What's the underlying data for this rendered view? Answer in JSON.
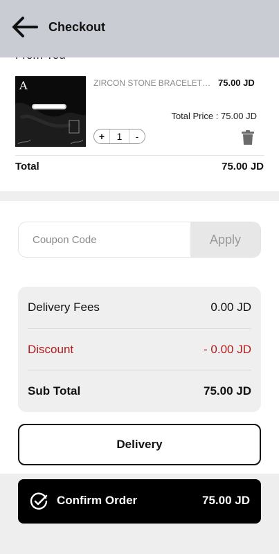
{
  "header": {
    "title": "Checkout",
    "back_icon": "arrow-left-icon"
  },
  "section": {
    "heading_partial": "From You"
  },
  "cart": {
    "items": [
      {
        "name": "ZIRCON STONE BRACELETZ...",
        "price": "75.00 JD",
        "total_price": "Total Price : 75.00 JD",
        "quantity": "1",
        "increase": "+",
        "decrease": "-"
      }
    ],
    "total_label": "Total",
    "total_value": "75.00 JD"
  },
  "coupon": {
    "placeholder": "Coupon Code",
    "value": "",
    "apply_label": "Apply"
  },
  "summary": {
    "delivery_label": "Delivery Fees",
    "delivery_value": "0.00 JD",
    "discount_label": "Discount",
    "discount_value": "- 0.00 JD",
    "subtotal_label": "Sub Total",
    "subtotal_value": "75.00 JD"
  },
  "delivery_button": {
    "label": "Delivery"
  },
  "confirm": {
    "label": "Confirm Order",
    "amount": "75.00 JD",
    "icon": "check-circle-icon"
  },
  "colors": {
    "header_bg": "#c9cdd3",
    "discount": "#b01b1b",
    "confirm_bg": "#000000"
  }
}
